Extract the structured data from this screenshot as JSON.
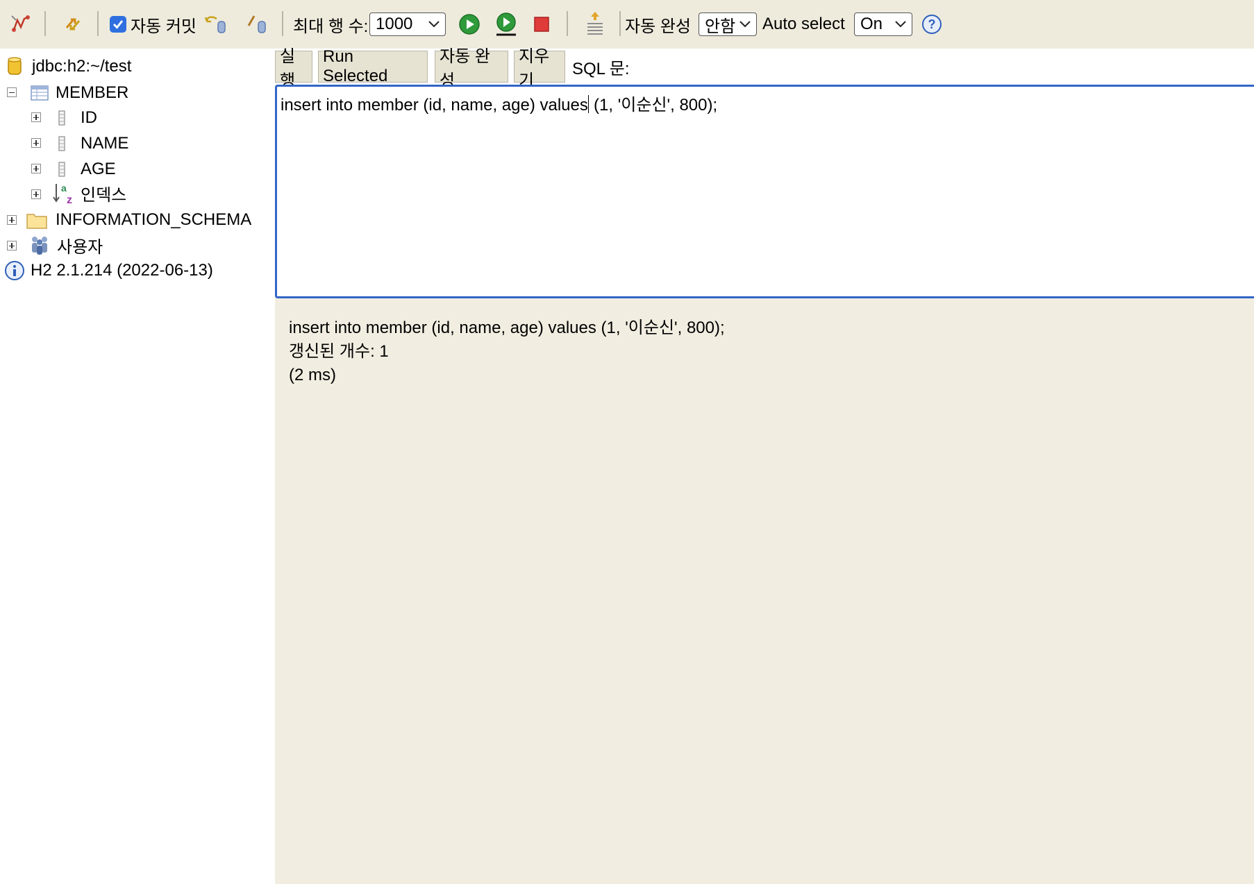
{
  "toolbar": {
    "autocommit_label": "자동 커밋",
    "autocommit_checked": true,
    "max_rows_label": "최대 행 수:",
    "max_rows_value": "1000",
    "autocomplete_label": "자동 완성",
    "autocomplete_value": "안함",
    "autoselect_label": "Auto select",
    "autoselect_value": "On"
  },
  "tree": {
    "connection": "jdbc:h2:~/test",
    "table": "MEMBER",
    "columns": [
      "ID",
      "NAME",
      "AGE"
    ],
    "indexes_label": "인덱스",
    "schema": "INFORMATION_SCHEMA",
    "users_label": "사용자",
    "version": "H2 2.1.214 (2022-06-13)"
  },
  "editor": {
    "run_label": "실행",
    "run_selected_label": "Run Selected",
    "autocomplete_label": "자동 완성",
    "clear_label": "지우기",
    "sql_label": "SQL 문:",
    "sql_before_caret": "insert into member (id, name, age) values",
    "sql_after_caret": " (1, '이순신', 800);"
  },
  "result": {
    "statement": "insert into member (id, name, age) values (1, '이순신', 800);",
    "update_count": "갱신된 개수: 1",
    "duration": "(2 ms)"
  },
  "colors": {
    "accent_blue": "#3265c6",
    "panel_bg": "#f1eee1",
    "run_green": "#2e9a3a",
    "stop_red": "#e03b3b"
  }
}
